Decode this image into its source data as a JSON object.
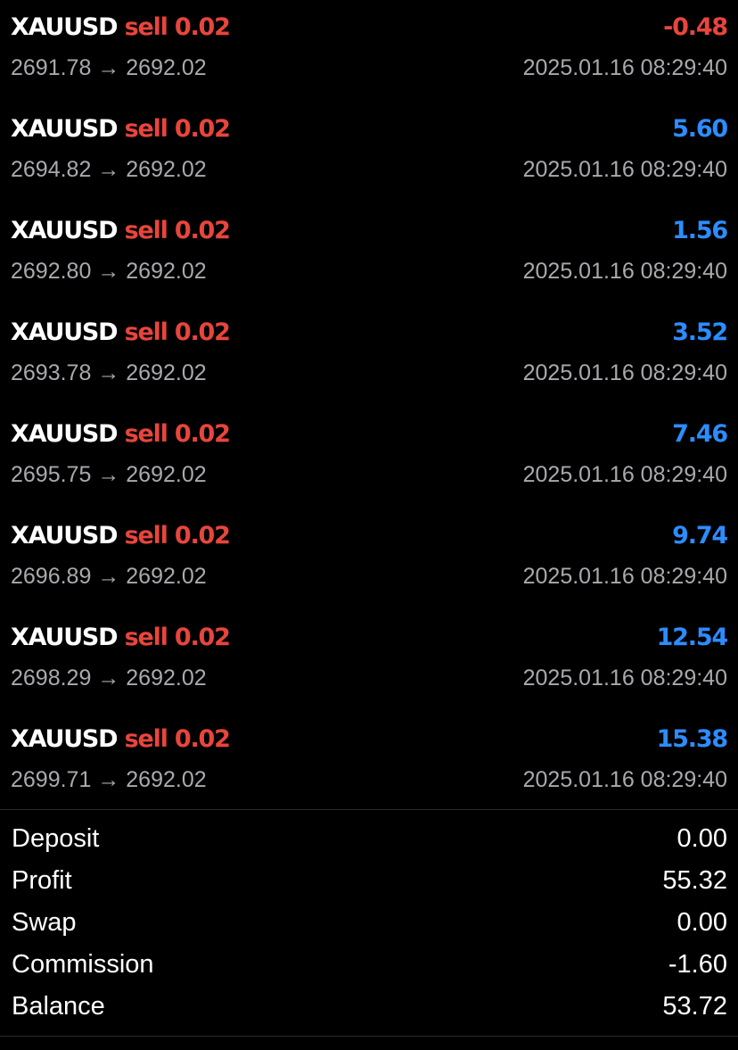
{
  "colors": {
    "background": "#000000",
    "sell": "#e8453c",
    "negative": "#e8453c",
    "positive": "#2d8cff",
    "secondary_text": "#a9a9ae"
  },
  "arrow": "→",
  "trades": [
    {
      "symbol": "XAUUSD",
      "side": "sell",
      "lot": "0.02",
      "profit": "-0.48",
      "sign": "neg",
      "open": "2691.78",
      "close": "2692.02",
      "time": "2025.01.16 08:29:40"
    },
    {
      "symbol": "XAUUSD",
      "side": "sell",
      "lot": "0.02",
      "profit": "5.60",
      "sign": "pos",
      "open": "2694.82",
      "close": "2692.02",
      "time": "2025.01.16 08:29:40"
    },
    {
      "symbol": "XAUUSD",
      "side": "sell",
      "lot": "0.02",
      "profit": "1.56",
      "sign": "pos",
      "open": "2692.80",
      "close": "2692.02",
      "time": "2025.01.16 08:29:40"
    },
    {
      "symbol": "XAUUSD",
      "side": "sell",
      "lot": "0.02",
      "profit": "3.52",
      "sign": "pos",
      "open": "2693.78",
      "close": "2692.02",
      "time": "2025.01.16 08:29:40"
    },
    {
      "symbol": "XAUUSD",
      "side": "sell",
      "lot": "0.02",
      "profit": "7.46",
      "sign": "pos",
      "open": "2695.75",
      "close": "2692.02",
      "time": "2025.01.16 08:29:40"
    },
    {
      "symbol": "XAUUSD",
      "side": "sell",
      "lot": "0.02",
      "profit": "9.74",
      "sign": "pos",
      "open": "2696.89",
      "close": "2692.02",
      "time": "2025.01.16 08:29:40"
    },
    {
      "symbol": "XAUUSD",
      "side": "sell",
      "lot": "0.02",
      "profit": "12.54",
      "sign": "pos",
      "open": "2698.29",
      "close": "2692.02",
      "time": "2025.01.16 08:29:40"
    },
    {
      "symbol": "XAUUSD",
      "side": "sell",
      "lot": "0.02",
      "profit": "15.38",
      "sign": "pos",
      "open": "2699.71",
      "close": "2692.02",
      "time": "2025.01.16 08:29:40"
    }
  ],
  "summary": [
    {
      "label": "Deposit",
      "value": "0.00"
    },
    {
      "label": "Profit",
      "value": "55.32"
    },
    {
      "label": "Swap",
      "value": "0.00"
    },
    {
      "label": "Commission",
      "value": "-1.60"
    },
    {
      "label": "Balance",
      "value": "53.72"
    }
  ]
}
